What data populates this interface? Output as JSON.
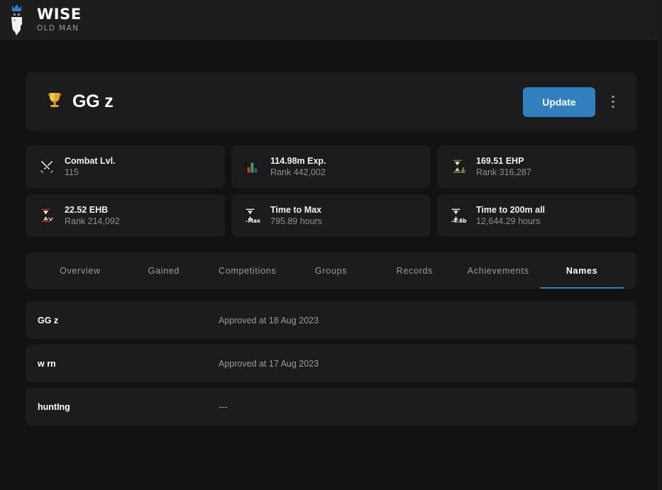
{
  "brand": {
    "title": "WISE",
    "subtitle": "OLD MAN",
    "logo_icon": "wise-old-man-logo",
    "crown_color": "#2f80c6"
  },
  "player": {
    "badge_icon": "trophy-icon",
    "name": "GG z",
    "update_label": "Update",
    "menu_icon": "kebab-menu-icon",
    "accent_color": "#2f7fc1"
  },
  "stats": [
    {
      "icon": "crossed-swords-icon",
      "title": "Combat Lvl.",
      "sub": "115"
    },
    {
      "icon": "bar-chart-icon",
      "title": "114.98m Exp.",
      "sub": "Rank 442,002"
    },
    {
      "icon": "green-hourglass-icon",
      "title": "169.51 EHP",
      "sub": "Rank 316,287"
    },
    {
      "icon": "red-hourglass-icon",
      "title": "22.52 EHB",
      "sub": "Rank 214,092"
    },
    {
      "icon": "hourglass-max-icon",
      "title": "Time to Max",
      "sub": "795.89 hours"
    },
    {
      "icon": "hourglass-200m-icon",
      "title": "Time to 200m all",
      "sub": "12,644.29 hours"
    }
  ],
  "tabs": [
    {
      "label": "Overview",
      "active": false
    },
    {
      "label": "Gained",
      "active": false
    },
    {
      "label": "Competitions",
      "active": false
    },
    {
      "label": "Groups",
      "active": false
    },
    {
      "label": "Records",
      "active": false
    },
    {
      "label": "Achievements",
      "active": false
    },
    {
      "label": "Names",
      "active": true
    }
  ],
  "names": [
    {
      "name": "GG z",
      "date": "Approved at 18 Aug 2023"
    },
    {
      "name": "w rn",
      "date": "Approved at 17 Aug 2023"
    },
    {
      "name": "huntIng",
      "date": "---"
    }
  ]
}
